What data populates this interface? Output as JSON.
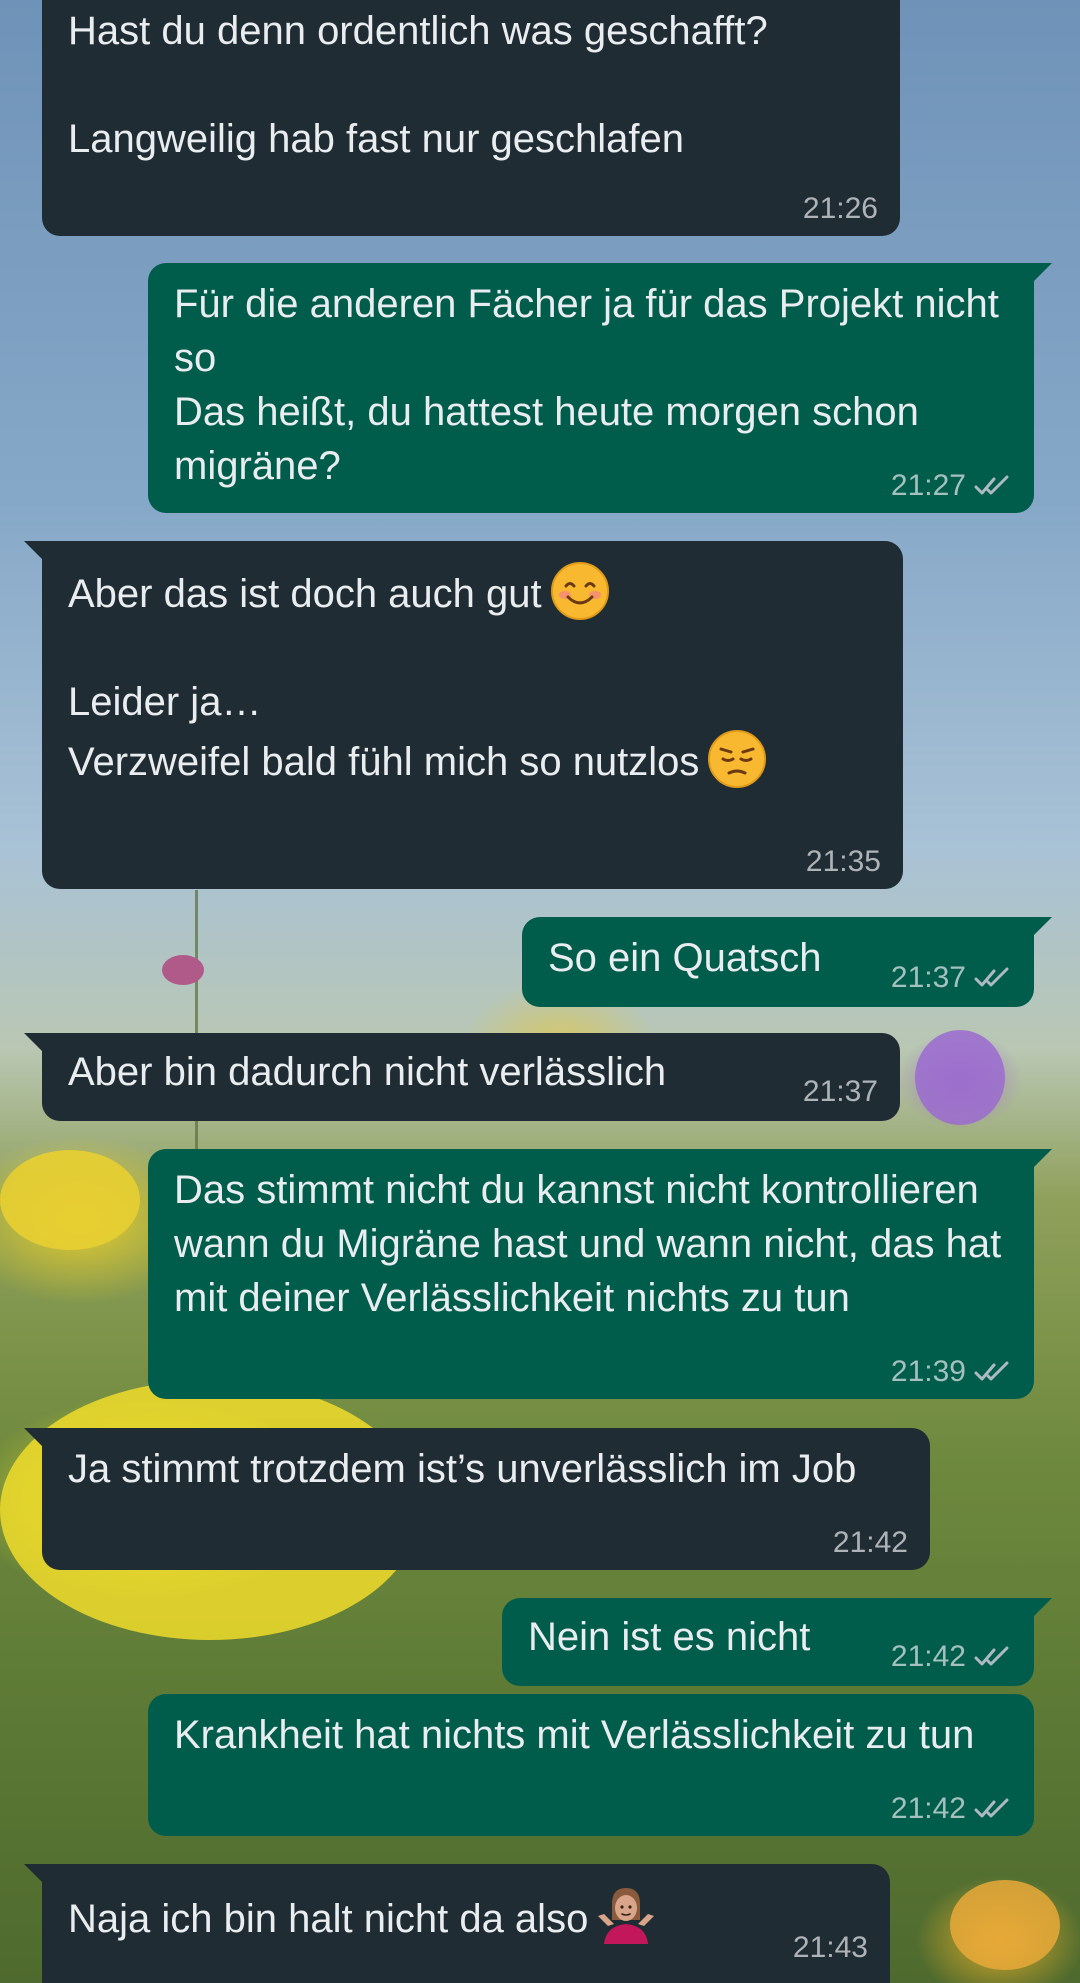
{
  "conversation": {
    "messages": [
      {
        "direction": "incoming",
        "text": "Hast du denn ordentlich was geschafft?\n\nLanggweilig hab fast nur geschlafen",
        "time": "21:26"
      },
      {
        "direction": "outgoing",
        "text": "Für die anderen Fächer ja für das Projekt nicht so\nDas heißt, du hattest heute morgen schon migräne?",
        "time": "21:27",
        "status": "read"
      },
      {
        "direction": "incoming",
        "text": "Aber das ist doch auch gut",
        "text2": "Leider ja…",
        "text3": "Verzweifel bald fühl mich so nutzlos",
        "time": "21:35",
        "emoji1": "smiling-face-emoji",
        "emoji2": "pensive-face-emoji"
      },
      {
        "direction": "outgoing",
        "text": "So ein Quatsch",
        "time": "21:37",
        "status": "read"
      },
      {
        "direction": "incoming",
        "text": "Aber bin dadurch nicht verlässlich",
        "time": "21:37"
      },
      {
        "direction": "outgoing",
        "text": "Das stimmt nicht du kannst nicht kontrollieren wann du Migräne hast und wann nicht, das hat mit deiner Verlässlichkeit nichts zu tun",
        "time": "21:39",
        "status": "read"
      },
      {
        "direction": "incoming",
        "text": "Ja stimmt trotzdem ist’s unverlässlich im Job",
        "time": "21:42"
      },
      {
        "direction": "outgoing",
        "text": "Nein ist es nicht",
        "time": "21:42",
        "status": "read"
      },
      {
        "direction": "outgoing",
        "text": "Krankheit hat nichts mit Verlässlichkeit zu tun",
        "time": "21:42",
        "status": "read"
      },
      {
        "direction": "incoming",
        "text": "Naja ich bin halt nicht da also",
        "time": "21:43",
        "emoji1": "person-shrugging-emoji"
      }
    ]
  },
  "colors": {
    "incoming_bubble": "#202c33",
    "outgoing_bubble": "#005c4b",
    "text": "#e9edef",
    "read_ticks": "#aebac1"
  }
}
